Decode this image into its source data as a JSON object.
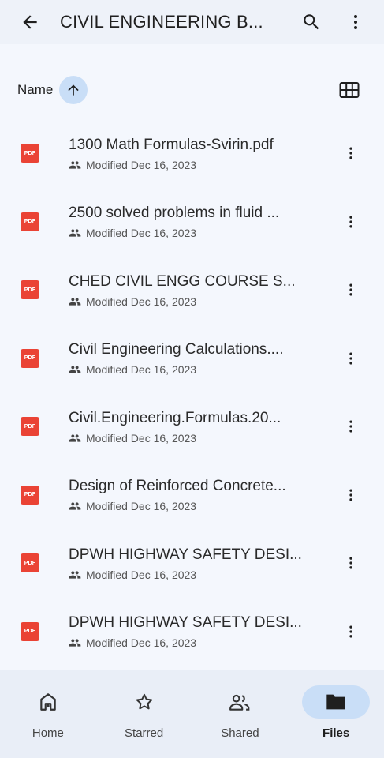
{
  "header": {
    "title": "CIVIL ENGINEERING B..."
  },
  "sort": {
    "label": "Name"
  },
  "files": [
    {
      "name": "1300 Math Formulas-Svirin.pdf",
      "modified": "Modified Dec 16, 2023",
      "type": "PDF"
    },
    {
      "name": "2500 solved problems in fluid ...",
      "modified": "Modified Dec 16, 2023",
      "type": "PDF"
    },
    {
      "name": "CHED CIVIL ENGG COURSE S...",
      "modified": "Modified Dec 16, 2023",
      "type": "PDF"
    },
    {
      "name": "Civil Engineering Calculations....",
      "modified": "Modified Dec 16, 2023",
      "type": "PDF"
    },
    {
      "name": "Civil.Engineering.Formulas.20...",
      "modified": "Modified Dec 16, 2023",
      "type": "PDF"
    },
    {
      "name": "Design of Reinforced Concrete...",
      "modified": "Modified Dec 16, 2023",
      "type": "PDF"
    },
    {
      "name": "DPWH HIGHWAY SAFETY DESI...",
      "modified": "Modified Dec 16, 2023",
      "type": "PDF"
    },
    {
      "name": "DPWH HIGHWAY SAFETY DESI...",
      "modified": "Modified Dec 16, 2023",
      "type": "PDF"
    }
  ],
  "nav": [
    {
      "label": "Home",
      "icon": "home-icon"
    },
    {
      "label": "Starred",
      "icon": "star-icon"
    },
    {
      "label": "Shared",
      "icon": "people-icon"
    },
    {
      "label": "Files",
      "icon": "folder-icon"
    }
  ],
  "colors": {
    "accent": "#c9def7",
    "pdf": "#ea4335",
    "background": "#f4f7fd"
  }
}
